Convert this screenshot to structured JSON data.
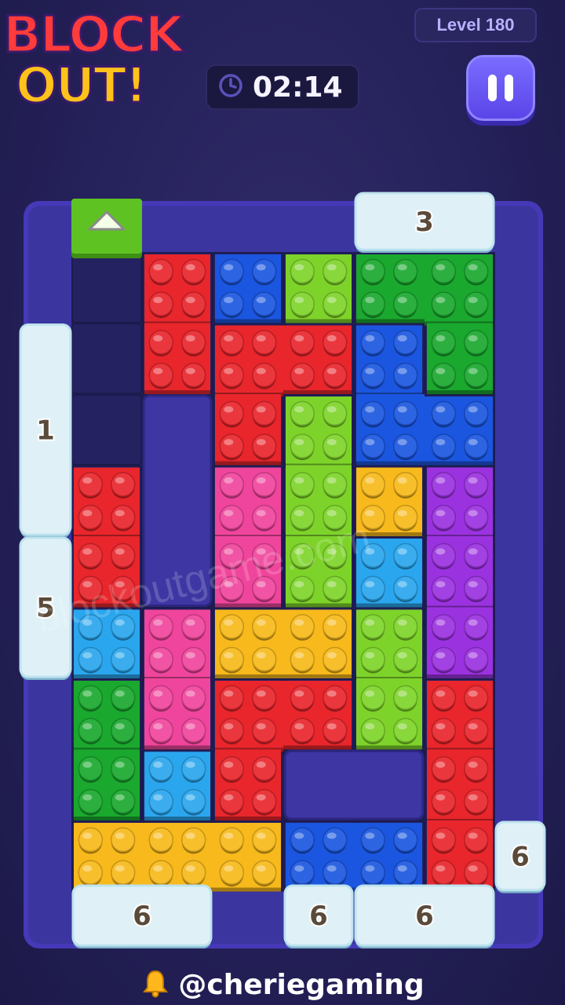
{
  "logo": {
    "line1": "BLOCK",
    "line2": "OUT!"
  },
  "level": {
    "label": "Level 180"
  },
  "timer": {
    "time": "02:14",
    "icon": "clock-icon"
  },
  "pause_button": {
    "icon": "pause-icon"
  },
  "footer": {
    "handle": "@cheriegaming",
    "icon": "bell-icon"
  },
  "watermark": "blockoutgame.com",
  "colors": {
    "red": "#e8262c",
    "blue": "#1b56e0",
    "lime": "#7ed32a",
    "green": "#1aa82e",
    "pink": "#f0459c",
    "yellow": "#f7b91b",
    "sky": "#2aa6ee",
    "purple": "#9b32e0",
    "board": "#3b35a0",
    "ice": "#dff1f7",
    "gate_green": "#5fc223"
  },
  "gates": [
    {
      "number": "3",
      "side": "top",
      "col": 4,
      "row": 0,
      "span": 2
    },
    {
      "number": "1",
      "side": "left",
      "col": 0,
      "row": 1,
      "span": 3
    },
    {
      "number": "5",
      "side": "left",
      "col": 0,
      "row": 4,
      "span": 2
    },
    {
      "number": "6",
      "side": "right",
      "col": 6,
      "row": 8,
      "span": 1
    },
    {
      "number": "6",
      "side": "bottom",
      "col": 0,
      "row": 9,
      "span": 2
    },
    {
      "number": "6",
      "side": "bottom",
      "col": 3,
      "row": 9,
      "span": 1
    },
    {
      "number": "6",
      "side": "bottom",
      "col": 4,
      "row": 9,
      "span": 2
    }
  ],
  "exit_gate": {
    "side": "top",
    "col": 0,
    "icon": "up-arrow-icon"
  },
  "blocks": [
    {
      "color": "red",
      "cells": [
        [
          1,
          0
        ],
        [
          1,
          1
        ]
      ]
    },
    {
      "color": "blue",
      "cells": [
        [
          2,
          0
        ]
      ]
    },
    {
      "color": "lime",
      "cells": [
        [
          3,
          0
        ]
      ]
    },
    {
      "color": "green",
      "cells": [
        [
          4,
          0
        ],
        [
          5,
          0
        ],
        [
          5,
          1
        ]
      ]
    },
    {
      "color": "red",
      "cells": [
        [
          2,
          1
        ],
        [
          3,
          1
        ],
        [
          2,
          2
        ]
      ]
    },
    {
      "color": "blue",
      "cells": [
        [
          4,
          1
        ],
        [
          4,
          2
        ],
        [
          5,
          2
        ]
      ]
    },
    {
      "color": "lime",
      "cells": [
        [
          3,
          2
        ],
        [
          3,
          3
        ],
        [
          3,
          4
        ]
      ]
    },
    {
      "color": "red",
      "cells": [
        [
          0,
          3
        ],
        [
          0,
          4
        ]
      ]
    },
    {
      "color": "pink",
      "cells": [
        [
          2,
          3
        ],
        [
          2,
          4
        ]
      ]
    },
    {
      "color": "yellow",
      "cells": [
        [
          4,
          3
        ]
      ]
    },
    {
      "color": "purple",
      "cells": [
        [
          5,
          3
        ],
        [
          5,
          4
        ],
        [
          5,
          5
        ]
      ]
    },
    {
      "color": "sky",
      "cells": [
        [
          4,
          4
        ]
      ]
    },
    {
      "color": "sky",
      "cells": [
        [
          0,
          5
        ]
      ]
    },
    {
      "color": "pink",
      "cells": [
        [
          1,
          5
        ],
        [
          1,
          6
        ]
      ]
    },
    {
      "color": "yellow",
      "cells": [
        [
          2,
          5
        ],
        [
          3,
          5
        ]
      ]
    },
    {
      "color": "lime",
      "cells": [
        [
          4,
          5
        ],
        [
          4,
          6
        ]
      ]
    },
    {
      "color": "green",
      "cells": [
        [
          0,
          6
        ],
        [
          0,
          7
        ]
      ]
    },
    {
      "color": "red",
      "cells": [
        [
          2,
          6
        ],
        [
          3,
          6
        ],
        [
          2,
          7
        ]
      ]
    },
    {
      "color": "red",
      "cells": [
        [
          5,
          6
        ],
        [
          5,
          7
        ],
        [
          5,
          8
        ]
      ]
    },
    {
      "color": "sky",
      "cells": [
        [
          1,
          7
        ]
      ]
    },
    {
      "color": "yellow",
      "cells": [
        [
          0,
          8
        ],
        [
          1,
          8
        ],
        [
          2,
          8
        ]
      ]
    },
    {
      "color": "blue",
      "cells": [
        [
          3,
          8
        ],
        [
          4,
          8
        ]
      ]
    }
  ],
  "walls": [
    {
      "cells": [
        [
          1,
          2
        ],
        [
          1,
          3
        ],
        [
          1,
          4
        ]
      ]
    },
    {
      "cells": [
        [
          3,
          7
        ],
        [
          4,
          7
        ]
      ]
    }
  ]
}
